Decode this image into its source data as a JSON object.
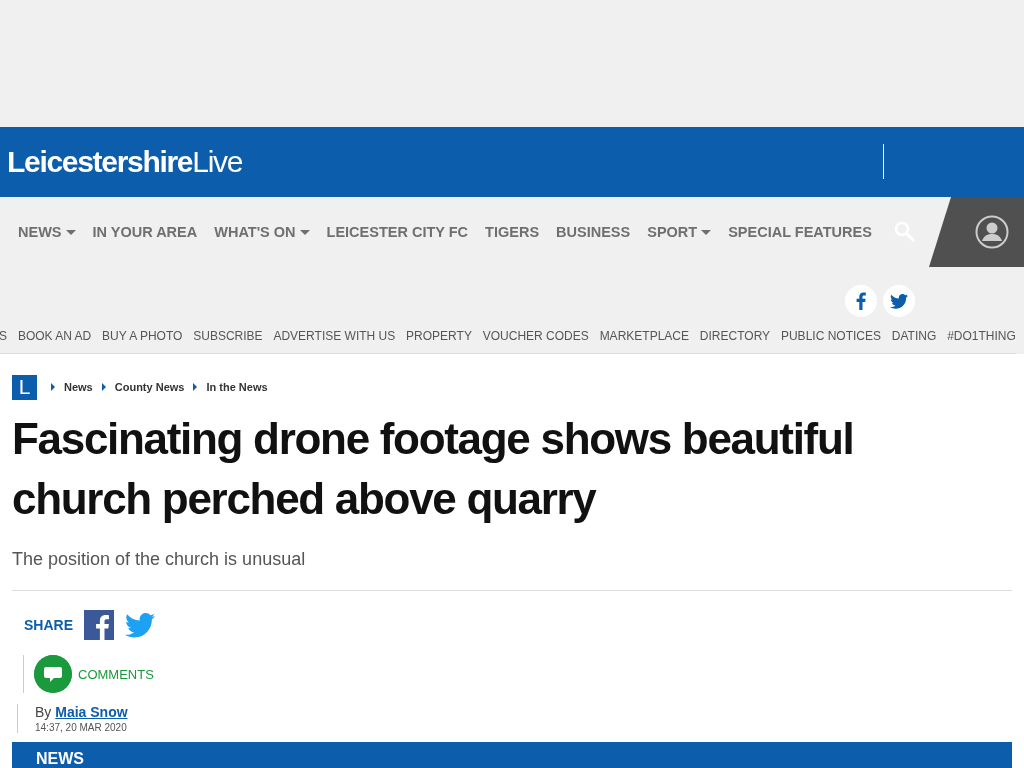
{
  "header": {
    "logo_bold": "Leicestershire",
    "logo_light": "Live"
  },
  "main_nav": [
    {
      "label": "NEWS",
      "dropdown": true
    },
    {
      "label": "IN YOUR AREA",
      "dropdown": false
    },
    {
      "label": "WHAT'S ON",
      "dropdown": true
    },
    {
      "label": "LEICESTER CITY FC",
      "dropdown": false
    },
    {
      "label": "TIGERS",
      "dropdown": false
    },
    {
      "label": "BUSINESS",
      "dropdown": false
    },
    {
      "label": "SPORT",
      "dropdown": true
    },
    {
      "label": "SPECIAL FEATURES",
      "dropdown": false
    }
  ],
  "secondary_nav": [
    "S",
    "BOOK AN AD",
    "BUY A PHOTO",
    "SUBSCRIBE",
    "ADVERTISE WITH US",
    "PROPERTY",
    "VOUCHER CODES",
    "MARKETPLACE",
    "DIRECTORY",
    "PUBLIC NOTICES",
    "DATING",
    "#DO1THING"
  ],
  "breadcrumb": {
    "logo": "L",
    "items": [
      "News",
      "County News",
      "In the News"
    ]
  },
  "article": {
    "headline": "Fascinating drone footage shows beautiful church perched above quarry",
    "standfirst": "The position of the church is unusual",
    "share_label": "SHARE",
    "comments_label": "COMMENTS",
    "byline_prefix": "By",
    "author": "Maia Snow",
    "timestamp": "14:37, 20 MAR 2020",
    "section_label": "NEWS"
  }
}
